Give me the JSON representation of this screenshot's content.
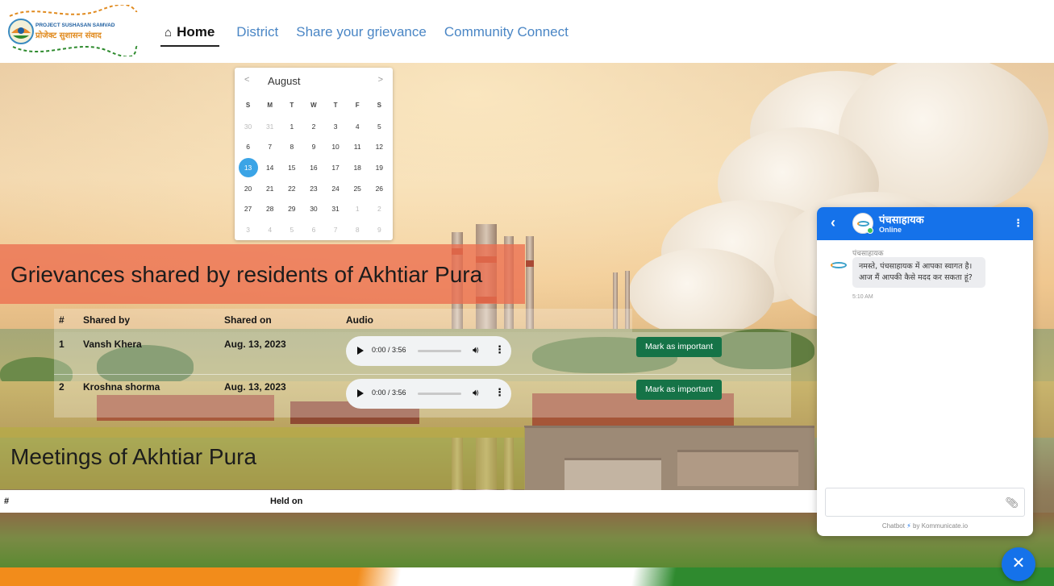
{
  "header": {
    "logo_text_en": "PROJECT SUSHASAN SAMVAD",
    "logo_text_hi": "प्रोजेक्ट सुशासन संवाद",
    "nav": [
      {
        "label": "Home",
        "icon": "home-icon",
        "active": true
      },
      {
        "label": "District"
      },
      {
        "label": "Share your grievance"
      },
      {
        "label": "Community Connect"
      }
    ]
  },
  "calendar": {
    "month": "August",
    "prev": "<",
    "next": ">",
    "weekdays": [
      "S",
      "M",
      "T",
      "W",
      "T",
      "F",
      "S"
    ],
    "weeks": [
      [
        "30",
        "31",
        "1",
        "2",
        "3",
        "4",
        "5"
      ],
      [
        "6",
        "7",
        "8",
        "9",
        "10",
        "11",
        "12"
      ],
      [
        "13",
        "14",
        "15",
        "16",
        "17",
        "18",
        "19"
      ],
      [
        "20",
        "21",
        "22",
        "23",
        "24",
        "25",
        "26"
      ],
      [
        "27",
        "28",
        "29",
        "30",
        "31",
        "1",
        "2"
      ],
      [
        "3",
        "4",
        "5",
        "6",
        "7",
        "8",
        "9"
      ]
    ],
    "selected": "13"
  },
  "grievances": {
    "title": "Grievances shared by residents of Akhtiar Pura",
    "columns": [
      "#",
      "Shared by",
      "Shared on",
      "Audio"
    ],
    "rows": [
      {
        "num": "1",
        "shared_by": "Vansh Khera",
        "shared_on": "Aug. 13, 2023",
        "audio_time": "0:00 / 3:56",
        "action": "Mark as important"
      },
      {
        "num": "2",
        "shared_by": "Kroshna shorma",
        "shared_on": "Aug. 13, 2023",
        "audio_time": "0:00 / 3:56",
        "action": "Mark as important"
      }
    ]
  },
  "meetings": {
    "title": "Meetings of Akhtiar Pura",
    "columns": [
      "#",
      "Held on"
    ]
  },
  "chat": {
    "bot_name": "पंचसाहायक",
    "status": "Online",
    "sender": "पंचसाहायक",
    "message_line1": "नमस्ते, पंचसाहायक में आपका स्वागत है।",
    "message_line2": "आज मैं आपकी कैसे मदद कर सकता हूं?",
    "time": "5:10 AM",
    "input_placeholder": "",
    "footer_prefix": "Chatbot",
    "footer_suffix": "by Kommunicate.io"
  },
  "icons": {
    "home": "home-icon",
    "back": "chevron-left-icon",
    "menu": "kebab-menu-icon",
    "attach": "paperclip-icon",
    "close": "close-icon",
    "play": "play-icon",
    "volume": "volume-icon"
  },
  "colors": {
    "accent": "#1572ea",
    "nav_link": "#4a86c5",
    "button_green": "#157347",
    "grievance_banner": "#ec6e50",
    "calendar_selected": "#3ba4e6"
  }
}
